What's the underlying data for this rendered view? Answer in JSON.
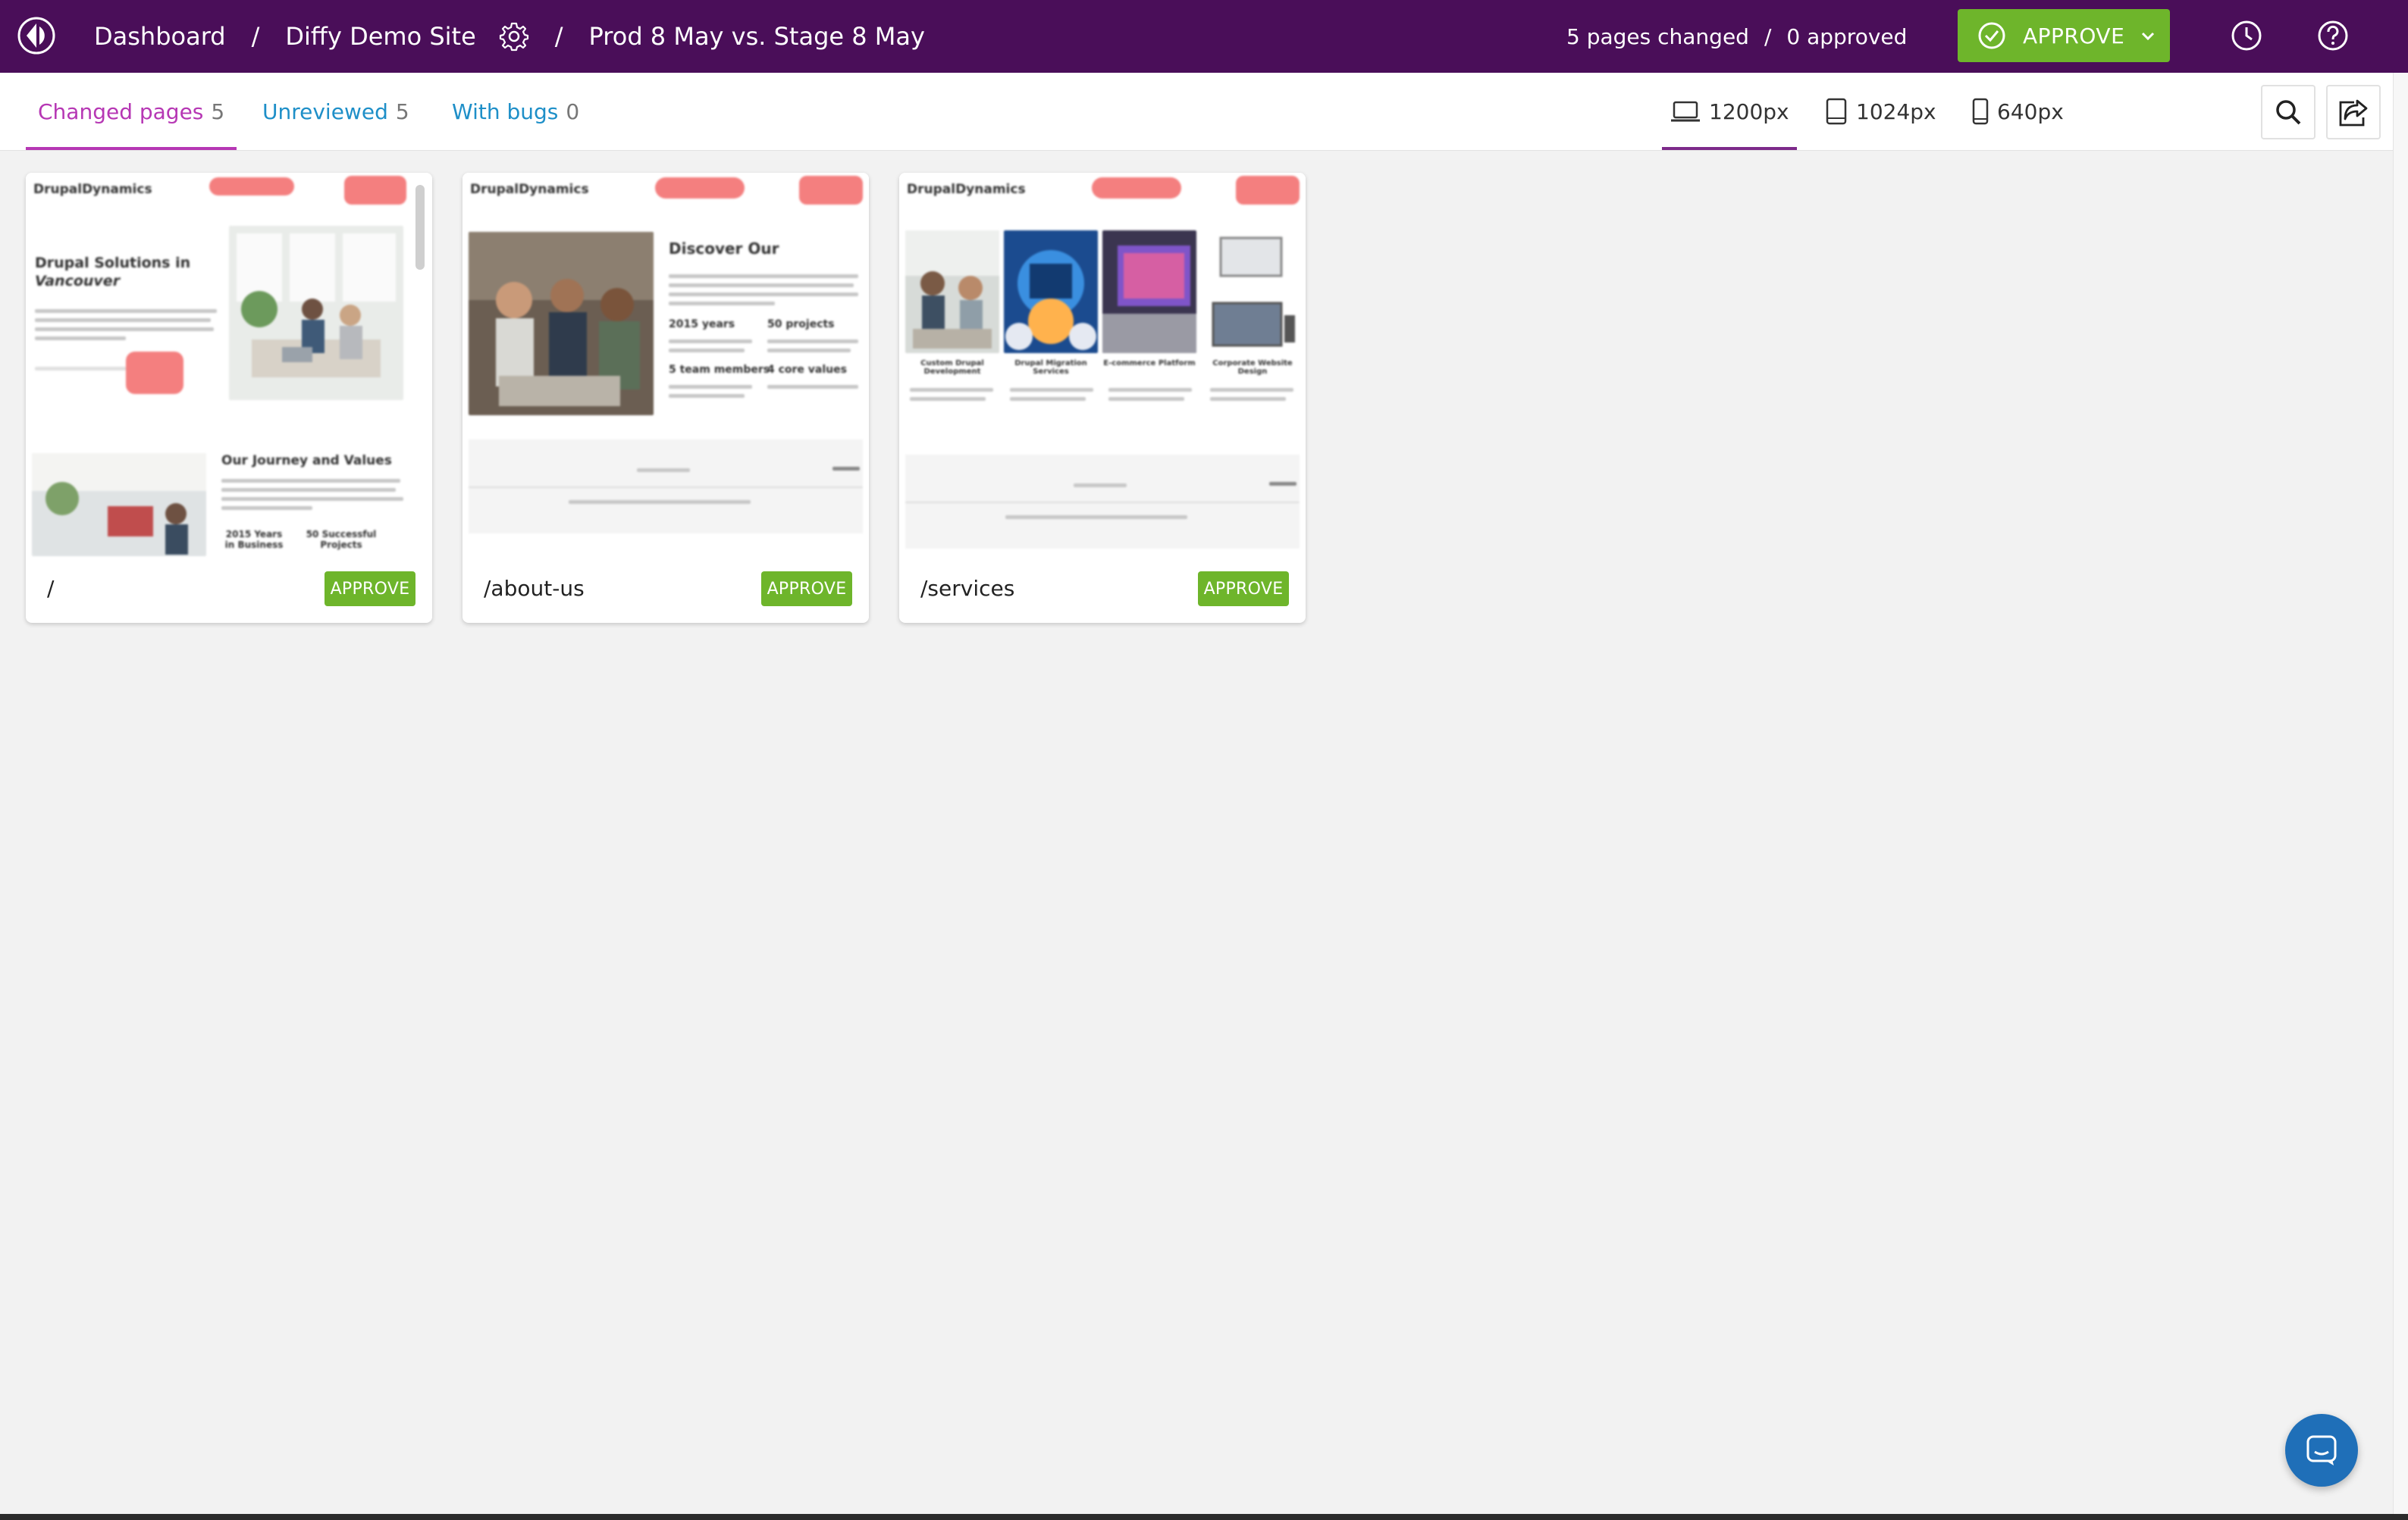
{
  "header": {
    "breadcrumbs": [
      "Dashboard",
      "Diffy Demo Site",
      "Prod 8 May vs. Stage 8 May"
    ],
    "separator": "/",
    "status_changed": "5 pages changed",
    "status_sep": "/",
    "status_approved": "0 approved",
    "approve_label": "APPROVE",
    "icons": [
      "diffy-logo-icon",
      "gear-icon",
      "check-circle-icon",
      "chevron-down-icon",
      "history-icon",
      "help-icon"
    ]
  },
  "tabs": [
    {
      "label": "Changed pages",
      "count": "5"
    },
    {
      "label": "Unreviewed",
      "count": "5"
    },
    {
      "label": "With bugs",
      "count": "0"
    }
  ],
  "resolutions": [
    {
      "label": "1200px",
      "icon": "laptop-icon"
    },
    {
      "label": "1024px",
      "icon": "tablet-icon"
    },
    {
      "label": "640px",
      "icon": "phone-icon"
    }
  ],
  "cards": [
    {
      "path": "/",
      "approve_label": "APPROVE",
      "preview": {
        "logo": "DrupalDynamics",
        "heading": "Drupal Solutions in",
        "heading_em": "Vancouver",
        "section": "Our Journey and Values",
        "stat1": "2015 Years in Business",
        "stat2": "50 Successful Projects"
      }
    },
    {
      "path": "/about-us",
      "approve_label": "APPROVE",
      "preview": {
        "logo": "DrupalDynamics",
        "heading": "Discover Our",
        "stat1": "2015 years",
        "stat2": "50 projects",
        "stat3": "5 team members",
        "stat4": "4 core values"
      }
    },
    {
      "path": "/services",
      "approve_label": "APPROVE",
      "preview": {
        "logo": "DrupalDynamics",
        "svc1": "Custom Drupal Development",
        "svc2": "Drupal Migration Services",
        "svc3": "E-commerce Platform",
        "svc4": "Corporate Website Design"
      }
    }
  ],
  "colors": {
    "topbar": "#4a0e59",
    "approve": "#6eb52b",
    "active_tab": "#b637b4",
    "link": "#1e8fc8",
    "highlight": "#f47f7f",
    "chat": "#1f6fb8"
  }
}
